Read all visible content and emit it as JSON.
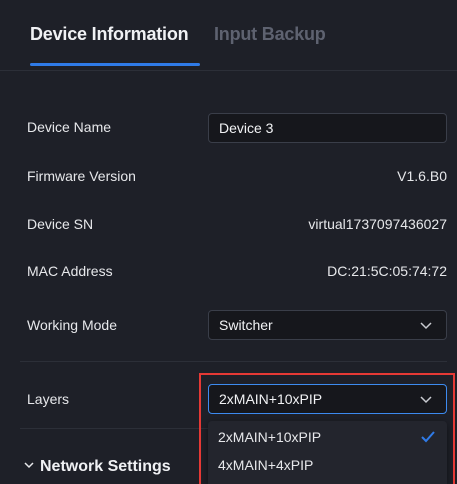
{
  "tabs": [
    {
      "label": "Device Information",
      "active": true
    },
    {
      "label": "Input Backup",
      "active": false
    }
  ],
  "fields": {
    "device_name": {
      "label": "Device Name",
      "value": "Device 3"
    },
    "firmware_version": {
      "label": "Firmware Version",
      "value": "V1.6.B0"
    },
    "device_sn": {
      "label": "Device SN",
      "value": "virtual1737097436027"
    },
    "mac_address": {
      "label": "MAC Address",
      "value": "DC:21:5C:05:74:72"
    },
    "working_mode": {
      "label": "Working Mode",
      "value": "Switcher"
    },
    "layers": {
      "label": "Layers",
      "value": "2xMAIN+10xPIP",
      "options": [
        "2xMAIN+10xPIP",
        "4xMAIN+4xPIP"
      ]
    }
  },
  "network_settings": {
    "label": "Network Settings",
    "expanded": false
  },
  "colors": {
    "background": "#1e2028",
    "accent": "#2f7be8",
    "highlight_frame": "#e53935"
  },
  "icons": {
    "select_chevron": "chevron-down-icon",
    "selected_option": "checkmark-icon",
    "section_toggle": "chevron-down-icon"
  }
}
